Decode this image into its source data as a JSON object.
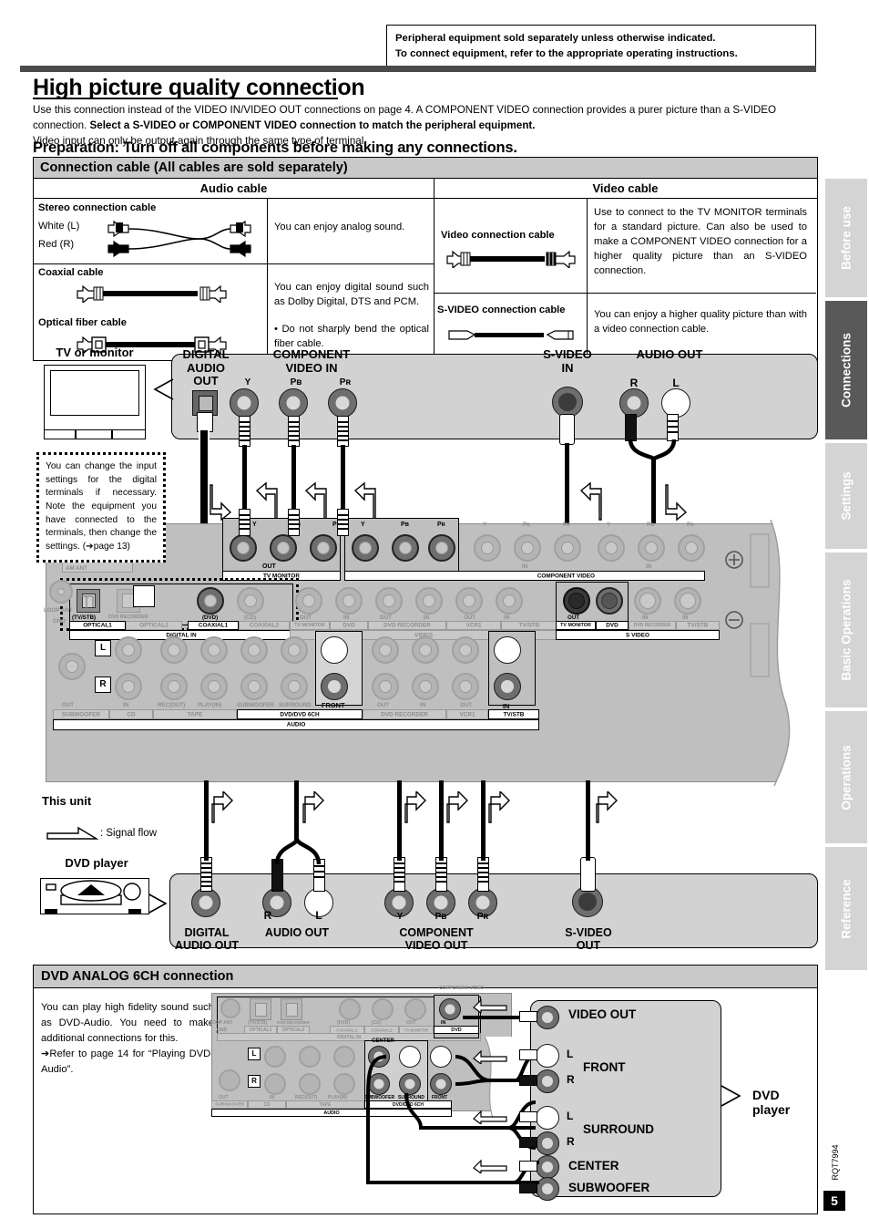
{
  "notice": {
    "line1": "Peripheral equipment sold separately unless otherwise indicated.",
    "line2": "To connect equipment, refer to the appropriate operating instructions."
  },
  "heading": "High picture quality connection",
  "intro": {
    "part1": "Use this connection instead of the VIDEO IN/VIDEO OUT connections on page 4. A COMPONENT VIDEO connection provides a purer picture than a S-VIDEO connection. ",
    "bold": "Select a S-VIDEO or COMPONENT VIDEO connection to match the peripheral equipment.",
    "part2": "Video input can only be output again through the same type of terminal."
  },
  "preparation": "Preparation: Turn off all components before making any connections.",
  "cable_table": {
    "title": "Connection cable (All cables are sold separately)",
    "col_audio": "Audio cable",
    "col_video": "Video cable",
    "audio_rows": [
      {
        "name": "Stereo connection cable",
        "white": "White (L)",
        "red": "Red   (R)",
        "desc": "You can enjoy analog sound."
      },
      {
        "name": "Coaxial cable",
        "name2": "Optical fiber cable",
        "desc": "You can enjoy digital sound such as Dolby Digital, DTS and PCM.",
        "bullet": "• Do not sharply bend the optical fiber cable."
      }
    ],
    "video_rows": [
      {
        "name": "Video connection cable",
        "desc": "Use to connect to the TV MONITOR terminals for a standard picture. Can also be used to make a COMPONENT VIDEO connection for a higher quality picture than an S-VIDEO connection."
      },
      {
        "name": "S-VIDEO connection cable",
        "desc": "You can enjoy a higher quality picture than with a video connection cable."
      }
    ]
  },
  "sidebar": {
    "tabs": [
      {
        "label": "Before use",
        "active": false
      },
      {
        "label": "Connections",
        "active": true
      },
      {
        "label": "Settings",
        "active": false
      },
      {
        "label": "Basic Operations",
        "active": false
      },
      {
        "label": "Operations",
        "active": false
      },
      {
        "label": "Reference",
        "active": false
      }
    ],
    "doc_code": "RQT7994",
    "page_number": "5"
  },
  "diagram": {
    "tv_caption": "TV or monitor",
    "this_unit": "This unit",
    "signal_flow": ": Signal flow",
    "dvd_player": "DVD player",
    "callout": "You can change the input settings for the digital terminals if necessary. Note the equipment you have connected to the terminals, then change the settings. (➔page 13)",
    "tv_ports": {
      "digital_audio_out": "DIGITAL\nAUDIO\nOUT",
      "component_video_in": "COMPONENT\nVIDEO IN",
      "y": "Y",
      "pb": "Pʙ",
      "pr": "Pʀ",
      "svideo_in": "S-VIDEO\nIN",
      "audio_out": "AUDIO OUT",
      "r": "R",
      "l": "L"
    },
    "dvd_ports": {
      "digital_audio_out": "DIGITAL\nAUDIO OUT",
      "audio_out": "AUDIO OUT",
      "r": "R",
      "l": "L",
      "component_video_out": "COMPONENT\nVIDEO OUT",
      "y": "Y",
      "pb": "Pʙ",
      "pr": "Pʀ",
      "svideo_out": "S-VIDEO\nOUT"
    },
    "rear_labels": {
      "loop_ant": "LOOP ANT",
      "gnd": "GND",
      "tvstb": "(TV/STB)",
      "optical1": "OPTICAL1",
      "dvd_recorder_small": "DVD RECORDER",
      "optical2": "OPTICAL2",
      "digital_in": "DIGITAL IN",
      "dvd_paren": "(DVD)",
      "coaxial1": "COAXIAL1",
      "cd_paren": "(CD)",
      "coaxial2": "COAXIAL2",
      "out": "OUT",
      "in": "IN",
      "tv_monitor": "TV MONITOR",
      "dvd": "DVD",
      "dvd_recorder": "DVD RECORDER",
      "vcr1": "VCR1",
      "tvstb2": "TV/STB",
      "component_video": "COMPONENT VIDEO",
      "video": "VIDEO",
      "s_video": "S VIDEO",
      "subwoofer": "SUBWOOFER",
      "cd": "CD",
      "rec_out": "REC(OUT)",
      "play_in": "PLAY(IN)",
      "tape": "TAPE",
      "subwoofer_6ch": "SUBWOOFER",
      "surround": "SURROUND",
      "front": "FRONT",
      "center": "CENTER",
      "dvd_6ch": "DVD/DVD 6CH",
      "audio": "AUDIO",
      "y": "Y",
      "pb": "Pʙ",
      "pr": "Pʀ",
      "l": "L",
      "r": "R",
      "loop": "LOOP",
      "ext": "EXT",
      "am_ant": "AM ANT"
    }
  },
  "sixch": {
    "title": "DVD ANALOG 6CH connection",
    "text": "You can play high fidelity sound such as DVD-Audio. You need to make additional connections for this.",
    "text2": "➔Refer to page 14 for “Playing DVD-Audio”.",
    "dvd_player": "DVD player",
    "ports": [
      {
        "label": "VIDEO OUT",
        "channels": []
      },
      {
        "label": "FRONT",
        "channels": [
          "L",
          "R"
        ]
      },
      {
        "label": "SURROUND",
        "channels": [
          "L",
          "R"
        ]
      },
      {
        "label": "CENTER",
        "channels": []
      },
      {
        "label": "SUBWOOFER",
        "channels": []
      }
    ]
  }
}
